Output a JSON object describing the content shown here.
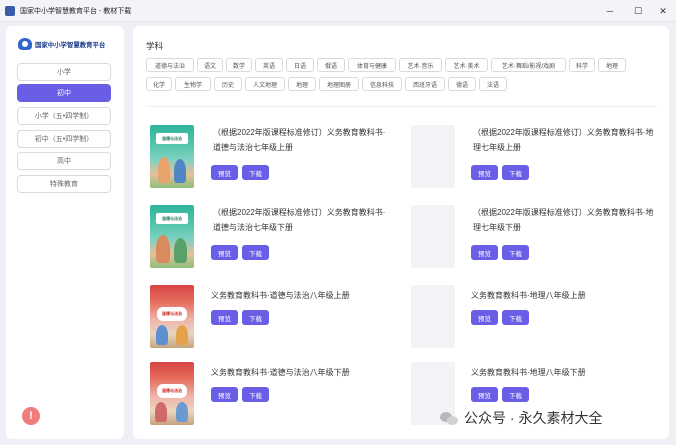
{
  "window": {
    "title": "国家中小学智慧教育平台 - 教材下载",
    "controls": {
      "minimize": "─",
      "maximize": "☐",
      "close": "✕"
    }
  },
  "sidebar": {
    "logo_text": "国家中小学智慧教育平台",
    "items": [
      {
        "label": "小学",
        "active": false
      },
      {
        "label": "初中",
        "active": true
      },
      {
        "label": "小学（五•四学制）",
        "active": false
      },
      {
        "label": "初中（五•四学制）",
        "active": false
      },
      {
        "label": "高中",
        "active": false
      },
      {
        "label": "特殊教育",
        "active": false
      }
    ],
    "info_icon": "!"
  },
  "main": {
    "section_label": "学科",
    "subjects_row1": [
      "道德与法治",
      "语文",
      "数学",
      "英语",
      "日语",
      "俄语",
      "体育与健康",
      "艺术·音乐",
      "艺术·美术",
      "艺术·舞蹈/影视/戏剧",
      "科学",
      "地理"
    ],
    "subjects_row2": [
      "化学",
      "生物学",
      "历史",
      "人文地理",
      "地理",
      "地理图册",
      "信息科技",
      "西班牙语",
      "德语",
      "法语"
    ],
    "books": [
      {
        "title": "（根据2022年版课程标准修订）义务教育教科书·道德与法治七年级上册",
        "cover": "cover-a"
      },
      {
        "title": "（根据2022年版课程标准修订）义务教育教科书·地理七年级上册",
        "cover": "blank"
      },
      {
        "title": "（根据2022年版课程标准修订）义务教育教科书·道德与法治七年级下册",
        "cover": "cover-a"
      },
      {
        "title": "（根据2022年版课程标准修订）义务教育教科书·地理七年级下册",
        "cover": "blank"
      },
      {
        "title": "义务教育教科书·道德与法治八年级上册",
        "cover": "cover-b"
      },
      {
        "title": "义务教育教科书·地理八年级上册",
        "cover": "blank"
      },
      {
        "title": "义务教育教科书·道德与法治八年级下册",
        "cover": "cover-b"
      },
      {
        "title": "义务教育教科书·地理八年级下册",
        "cover": "blank"
      }
    ],
    "preview_label": "预览",
    "download_label": "下载",
    "cover_text_a": "道德与法治",
    "cover_text_b": "道德与法治"
  },
  "watermark": "公众号 · 永久素材大全",
  "colors": {
    "accent": "#6a5de6",
    "logo": "#1f3e8c",
    "info": "#f07c7c"
  }
}
